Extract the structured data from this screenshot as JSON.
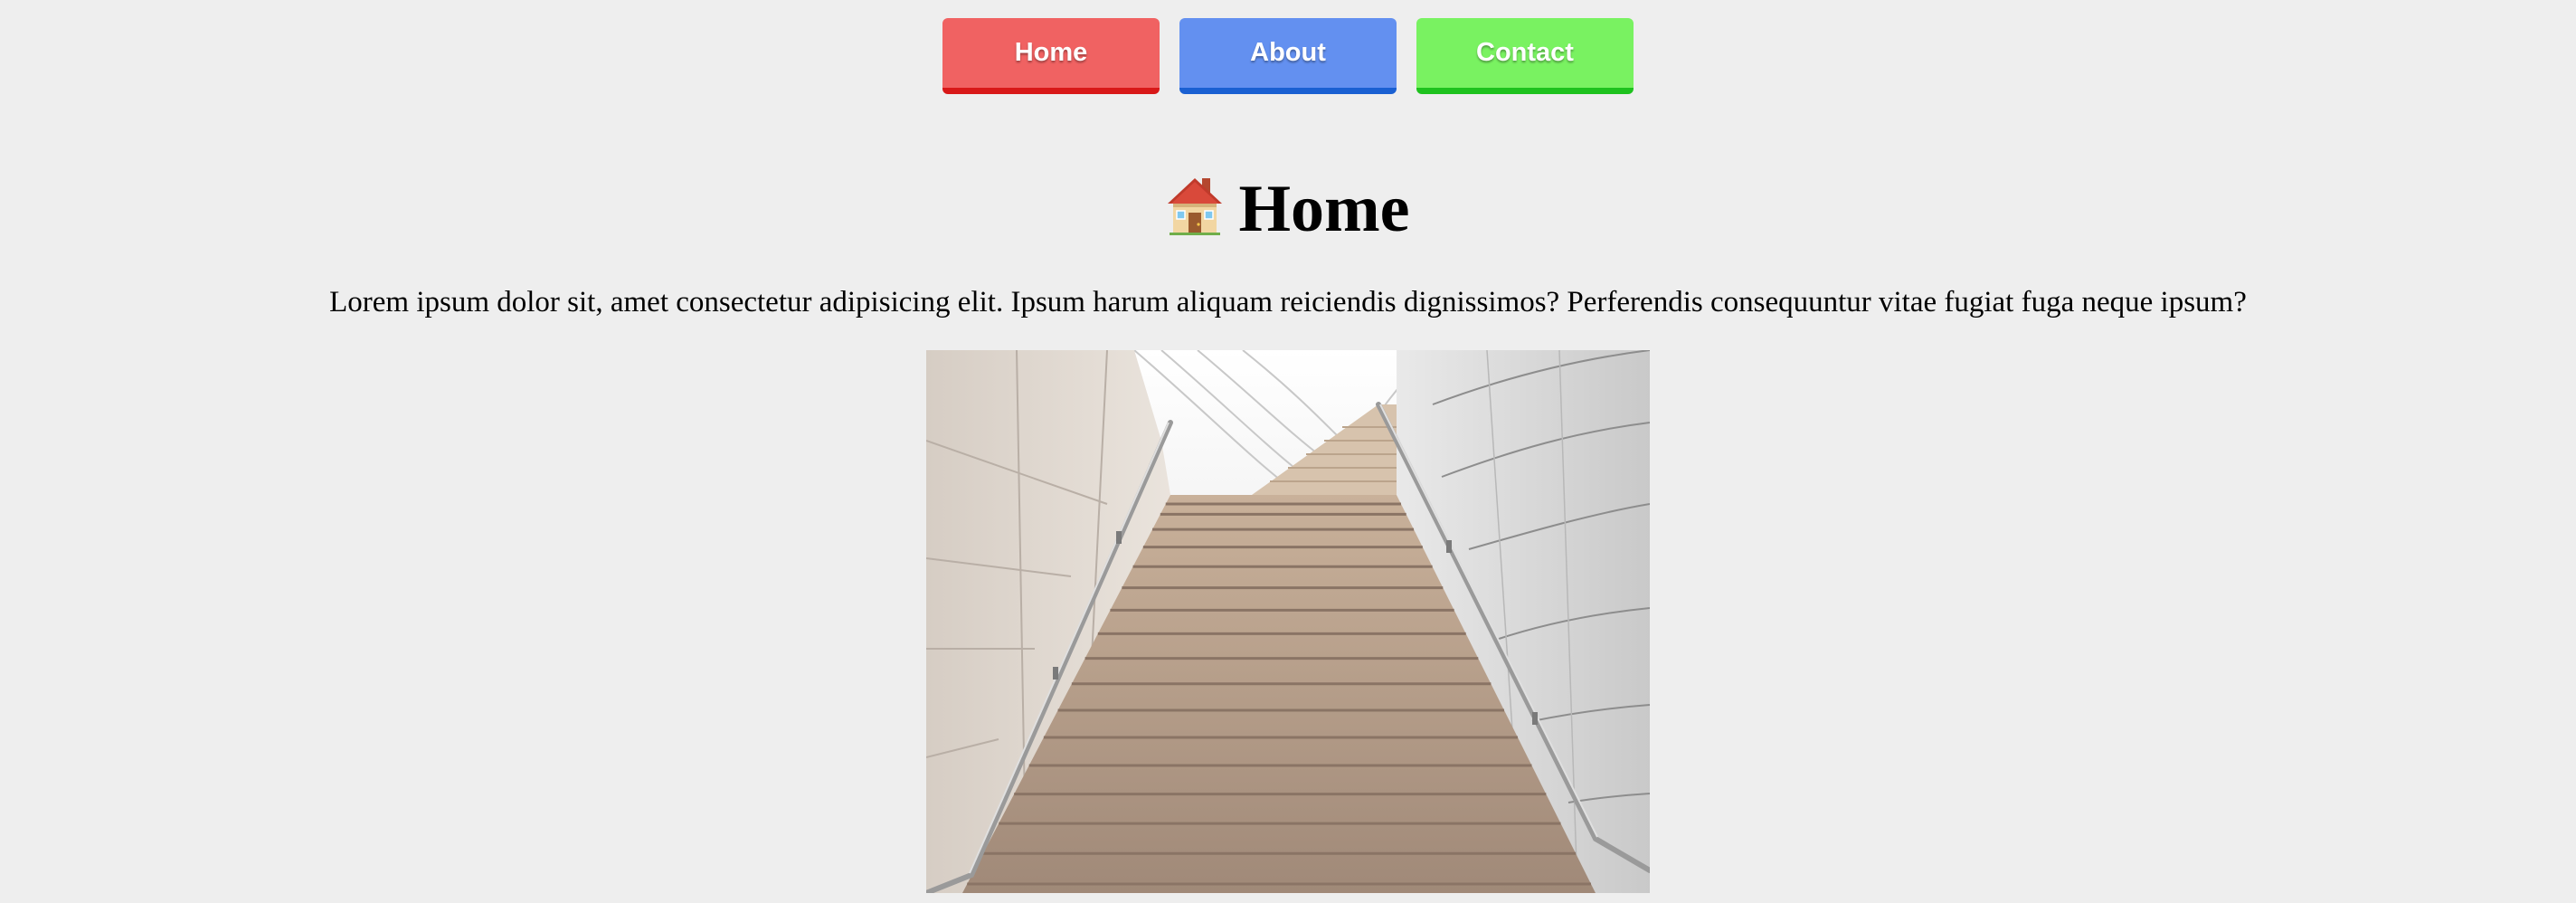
{
  "nav": {
    "items": [
      {
        "label": "Home",
        "color": "#f06262",
        "border_color": "#d81818"
      },
      {
        "label": "About",
        "color": "#6390f0",
        "border_color": "#1a60d2"
      },
      {
        "label": "Contact",
        "color": "#79f261",
        "border_color": "#1ec21e"
      }
    ]
  },
  "main": {
    "heading_icon": "house-icon",
    "heading": "Home",
    "paragraph": "Lorem ipsum dolor sit, amet consectetur adipisicing elit. Ipsum harum aliquam reiciendis dignissimos? Perferendis consequuntur vitae fugiat fuga neque ipsum?",
    "image_subject": "staircase-photo"
  },
  "colors": {
    "page_background": "#eeeeee",
    "text": "#000000"
  }
}
